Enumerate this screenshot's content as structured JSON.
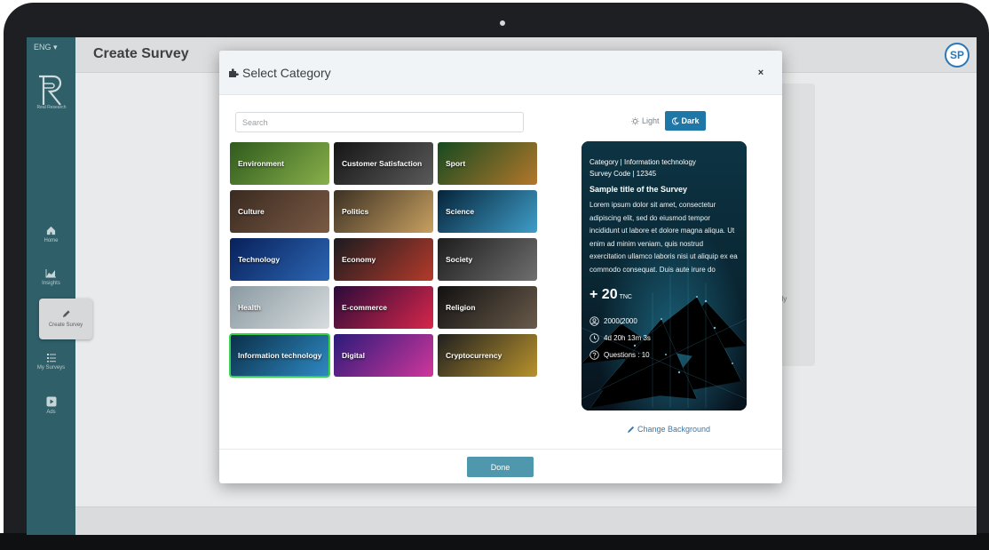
{
  "app": {
    "language": "ENG",
    "brand_text": "Real Research",
    "page_title": "Create Survey",
    "avatar_initials": "SP",
    "accent_color": "#1f77a8",
    "sidebar_color": "#2f5f68"
  },
  "sidebar": {
    "items": [
      {
        "label": "Home",
        "icon": "home-icon"
      },
      {
        "label": "Insights",
        "icon": "chart-icon"
      },
      {
        "label": "Create Survey",
        "icon": "pencil-icon",
        "active": true
      },
      {
        "label": "My Surveys",
        "icon": "list-icon"
      },
      {
        "label": "Ads",
        "icon": "play-icon"
      }
    ]
  },
  "background_fragments": [
    "y",
    "nly",
    "y."
  ],
  "modal": {
    "title": "Select Category",
    "close_label": "×",
    "search_placeholder": "Search",
    "theme": {
      "light_label": "Light",
      "dark_label": "Dark",
      "selected": "Dark"
    },
    "categories": [
      {
        "label": "Environment",
        "c1": "#2f5a1c",
        "c2": "#88b04b"
      },
      {
        "label": "Customer Satisfaction",
        "c1": "#161616",
        "c2": "#5a5a5a"
      },
      {
        "label": "Sport",
        "c1": "#164a20",
        "c2": "#b3772b"
      },
      {
        "label": "Culture",
        "c1": "#3a2a20",
        "c2": "#7a5a44"
      },
      {
        "label": "Politics",
        "c1": "#3c3124",
        "c2": "#c8a060"
      },
      {
        "label": "Science",
        "c1": "#06243a",
        "c2": "#3f9dc8"
      },
      {
        "label": "Technology",
        "c1": "#08205a",
        "c2": "#2c67b4"
      },
      {
        "label": "Economy",
        "c1": "#1b1b20",
        "c2": "#b43a2a"
      },
      {
        "label": "Society",
        "c1": "#1d1d1d",
        "c2": "#6f6f6f"
      },
      {
        "label": "Health",
        "c1": "#8a9aa2",
        "c2": "#d8dcde"
      },
      {
        "label": "E-commerce",
        "c1": "#2a0b3a",
        "c2": "#d8264a"
      },
      {
        "label": "Religion",
        "c1": "#111111",
        "c2": "#6a5a4a"
      },
      {
        "label": "Information technology",
        "c1": "#0a2f48",
        "c2": "#2f8ac4",
        "selected": true
      },
      {
        "label": "Digital",
        "c1": "#2a1b7a",
        "c2": "#d0369a"
      },
      {
        "label": "Cryptocurrency",
        "c1": "#202020",
        "c2": "#b8922c"
      }
    ],
    "preview": {
      "category_line": "Category | Information technology",
      "code_line": "Survey Code | 12345",
      "title": "Sample title of the Survey",
      "description": "Lorem ipsum dolor sit amet, consectetur adipiscing elit, sed do eiusmod tempor incididunt ut labore et dolore magna aliqua. Ut enim ad minim veniam, quis nostrud exercitation ullamco laboris nisi ut aliquip ex ea commodo consequat. Duis aute irure do",
      "reward": "+ 20",
      "currency": "TNC",
      "participants": "2000/2000",
      "time_left": "4d 20h 13m 3s",
      "questions": "Questions : 10"
    },
    "change_background_label": "Change Background",
    "done_label": "Done"
  }
}
